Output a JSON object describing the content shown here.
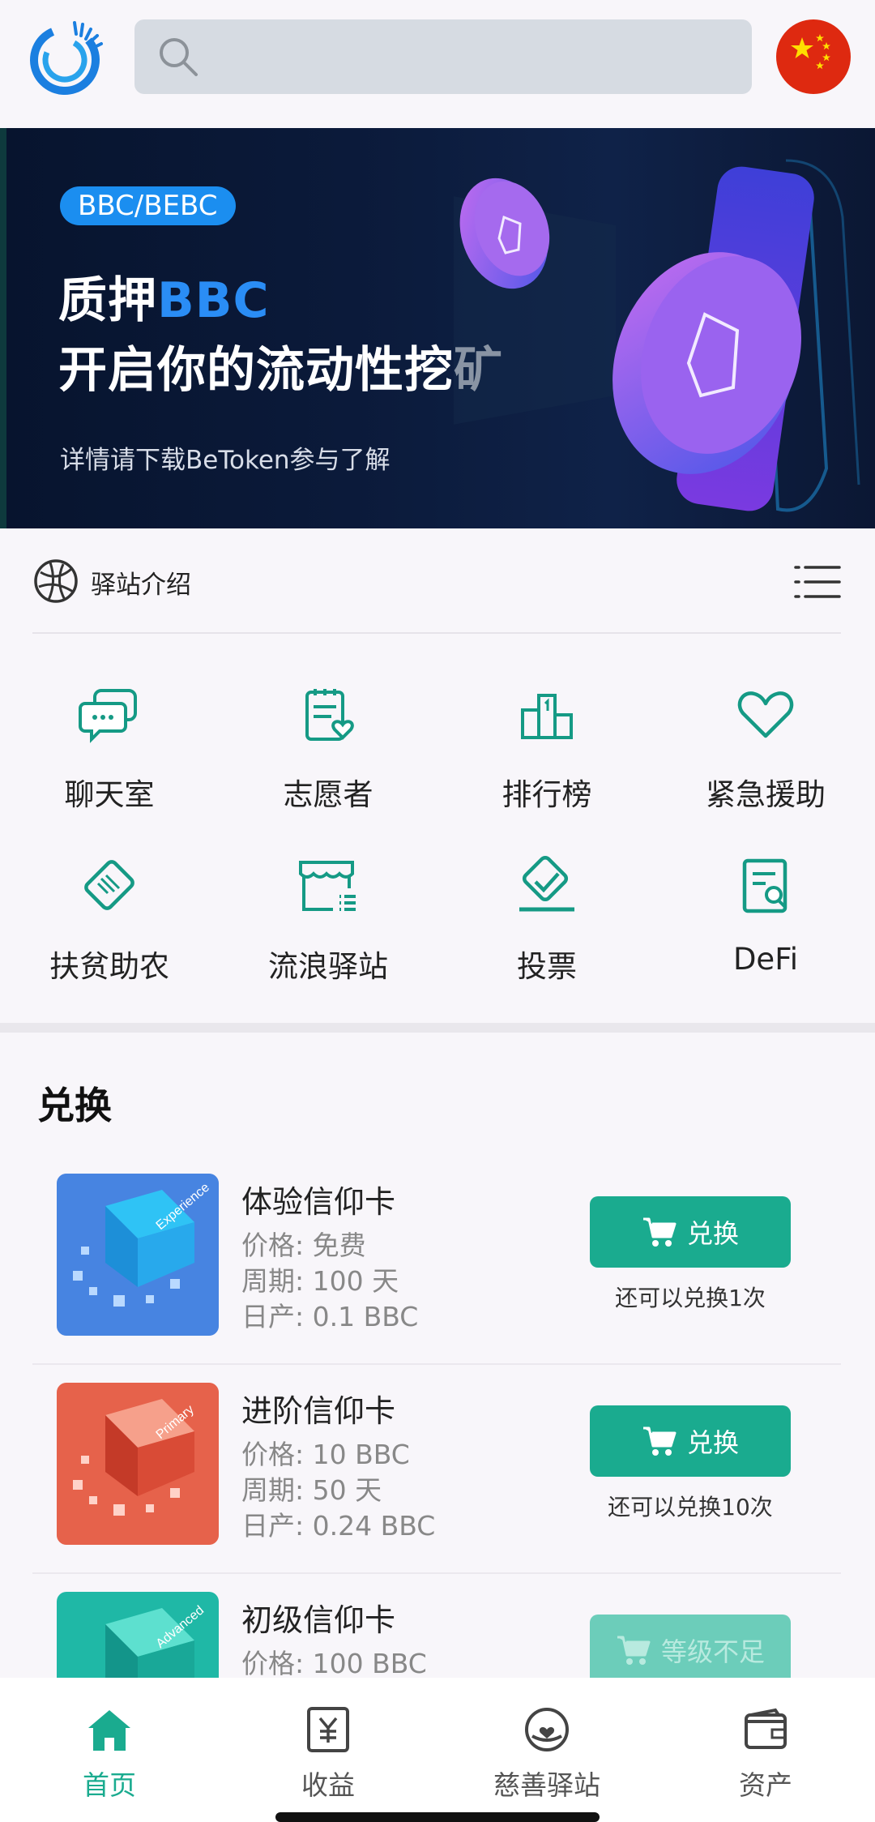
{
  "banner": {
    "tag": "BBC/BEBC",
    "headline_prefix": "质押",
    "headline_highlight": "BBC",
    "headline_line2": "开启你的流动性挖矿",
    "subtitle": "详情请下载BeToken参与了解"
  },
  "intro": {
    "label": "驿站介绍"
  },
  "grid": [
    {
      "label": "聊天室",
      "icon": "chat-icon"
    },
    {
      "label": "志愿者",
      "icon": "clipboard-heart-icon"
    },
    {
      "label": "排行榜",
      "icon": "podium-icon"
    },
    {
      "label": "紧急援助",
      "icon": "heart-icon"
    },
    {
      "label": "扶贫助农",
      "icon": "handshake-icon"
    },
    {
      "label": "流浪驿站",
      "icon": "shop-icon"
    },
    {
      "label": "投票",
      "icon": "vote-check-icon"
    },
    {
      "label": "DeFi",
      "icon": "document-search-icon"
    }
  ],
  "exchange": {
    "title": "兑换",
    "products": [
      {
        "name": "体验信仰卡",
        "price": "价格: 免费",
        "period": "周期: 100 天",
        "daily": "日产: 0.1 BBC",
        "button": "兑换",
        "note": "还可以兑换1次",
        "thumb_word": "Experience",
        "theme": "#2f7fe0"
      },
      {
        "name": "进阶信仰卡",
        "price": "价格: 10 BBC",
        "period": "周期: 50 天",
        "daily": "日产: 0.24 BBC",
        "button": "兑换",
        "note": "还可以兑换10次",
        "thumb_word": "Primary",
        "theme": "#e0523e"
      },
      {
        "name": "初级信仰卡",
        "price": "价格: 100 BBC",
        "button": "等级不足",
        "thumb_word": "Advanced",
        "theme": "#1fb8a6"
      }
    ]
  },
  "nav": [
    {
      "label": "首页",
      "icon": "home-icon",
      "active": true
    },
    {
      "label": "收益",
      "icon": "yen-receipt-icon",
      "active": false
    },
    {
      "label": "慈善驿站",
      "icon": "charity-icon",
      "active": false
    },
    {
      "label": "资产",
      "icon": "wallet-icon",
      "active": false
    }
  ],
  "colors": {
    "accent": "#1aab8f",
    "banner_bg": "#0b1a3a",
    "flag": "#de2910"
  }
}
